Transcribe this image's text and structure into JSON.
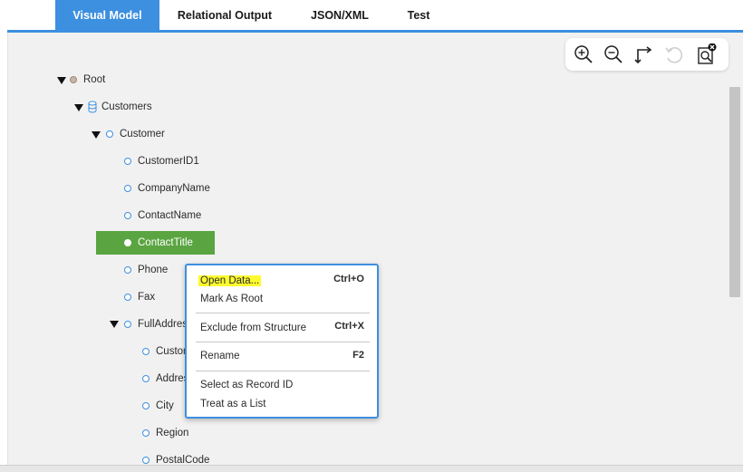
{
  "tabs": [
    {
      "label": "Visual Model",
      "active": true
    },
    {
      "label": "Relational Output",
      "active": false
    },
    {
      "label": "JSON/XML",
      "active": false
    },
    {
      "label": "Test",
      "active": false
    }
  ],
  "toolbar": {
    "icons": [
      "zoom-in-icon",
      "zoom-out-icon",
      "connector-icon",
      "undo-icon",
      "find-icon"
    ]
  },
  "tree": {
    "root": "Root",
    "customers": "Customers",
    "customer": "Customer",
    "fields": [
      "CustomerID1",
      "CompanyName",
      "ContactName",
      "ContactTitle",
      "Phone",
      "Fax"
    ],
    "full_address": "FullAddres",
    "address_fields": [
      "Custon",
      "Addres",
      "City",
      "Region",
      "PostalCode"
    ],
    "selected": "ContactTitle"
  },
  "context_menu": {
    "open_data": {
      "label": "Open Data...",
      "shortcut": "Ctrl+O"
    },
    "mark_as_root": {
      "label": "Mark As Root"
    },
    "exclude": {
      "label": "Exclude from Structure",
      "shortcut": "Ctrl+X"
    },
    "rename": {
      "label": "Rename",
      "shortcut": "F2"
    },
    "select_record_id": {
      "label": "Select as Record ID"
    },
    "treat_as_list": {
      "label": "Treat as a List"
    }
  },
  "colors": {
    "accent": "#3d8fe0",
    "selection": "#5aa541",
    "highlight": "#fdfb2e"
  }
}
